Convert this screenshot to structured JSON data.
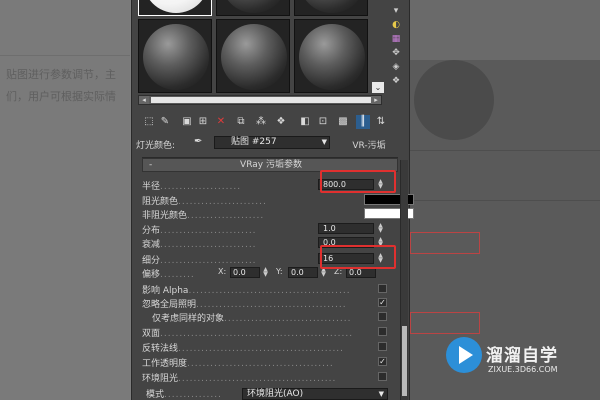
{
  "background": {
    "text_lines": [
      "贴图进行参数调节，主",
      "们，用户可根据实际情"
    ]
  },
  "toolbar": {
    "icons": [
      "get-material-icon",
      "put-to-scene-icon",
      "assign-to-selection-icon",
      "reset-map-icon",
      "make-unique-icon",
      "put-to-library-icon",
      "material-id-icon",
      "show-in-viewport-icon",
      "show-end-result-icon",
      "go-to-parent-icon",
      "go-forward-icon"
    ]
  },
  "light_row": {
    "label": "灯光颜色:",
    "map_name": "贴图 #257",
    "map_type": "VR-污垢"
  },
  "rollout": {
    "title": "VRay 污垢参数",
    "minus": "-",
    "radius_label": "半径",
    "radius_value": "800.0",
    "occluded_color_label": "阻光颜色",
    "unoccluded_color_label": "非阻光颜色",
    "distribution_label": "分布",
    "distribution_value": "1.0",
    "falloff_label": "衰减",
    "falloff_value": "0.0",
    "subdivs_label": "细分",
    "subdivs_value": "16",
    "bias_label": "偏移",
    "bias_x_label": "X:",
    "bias_x": "0.0",
    "bias_y_label": "Y:",
    "bias_y": "0.0",
    "bias_z_label": "Z:",
    "bias_z": "0.0",
    "affect_alpha_label": "影响 Alpha",
    "ignore_gi_label": "忽略全局照明",
    "same_object_label": "仅考虑同样的对象",
    "double_sided_label": "双面",
    "invert_normal_label": "反转法线",
    "work_transparency_label": "工作透明度",
    "env_occlusion_label": "环境阻光",
    "mode_label": "模式",
    "mode_value": "环境阻光(AO)"
  },
  "colors": {
    "occluded": "#000000",
    "unoccluded": "#ffffff",
    "highlight": "#e0302f"
  },
  "watermark": {
    "title": "溜溜自学",
    "url": "ZIXUE.3D66.COM"
  }
}
